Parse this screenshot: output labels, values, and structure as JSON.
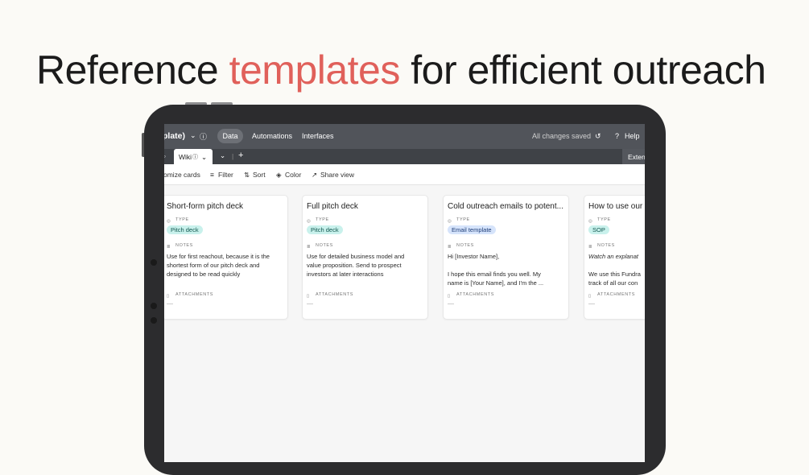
{
  "headline": {
    "part1": "Reference ",
    "accent": "templates",
    "part2": " for efficient outreach"
  },
  "colors": {
    "accent": "#e0605a",
    "topbar": "#51545a",
    "pitch_badge": "#c9f1ec",
    "email_badge": "#d6e4fb",
    "sop_badge": "#c9f1ec"
  },
  "app": {
    "base_title": "plate)",
    "nav": {
      "data": "Data",
      "automations": "Automations",
      "interfaces": "Interfaces"
    },
    "status": "All changes saved",
    "help": "Help",
    "view_tab": "Wiki",
    "extensions": "Extens",
    "toolbar": {
      "customize": "omize cards",
      "filter": "Filter",
      "sort": "Sort",
      "color": "Color",
      "share": "Share view"
    },
    "field_labels": {
      "type": "TYPE",
      "notes": "NOTES",
      "attachments": "ATTACHMENTS"
    },
    "cards": [
      {
        "title": "Short-form pitch deck",
        "type": "Pitch deck",
        "notes": [
          "Use for first reachout, because it is the",
          "shortest form of our pitch deck and",
          "designed to be read quickly"
        ]
      },
      {
        "title": "Full pitch deck",
        "type": "Pitch deck",
        "notes": [
          "Use for detailed business model and",
          "value proposition. Send to prospect",
          "investors at later interactions"
        ]
      },
      {
        "title": "Cold outreach emails to potent...",
        "type": "Email template",
        "notes": [
          "Hi [Investor Name],",
          "",
          "I hope this email finds you well. My",
          "name is [Your Name], and I'm the ..."
        ]
      },
      {
        "title": "How to use our",
        "type": "SOP",
        "notes": [
          "Watch an explanat",
          "",
          "We use this Fundra",
          "track of all our con"
        ]
      }
    ]
  }
}
